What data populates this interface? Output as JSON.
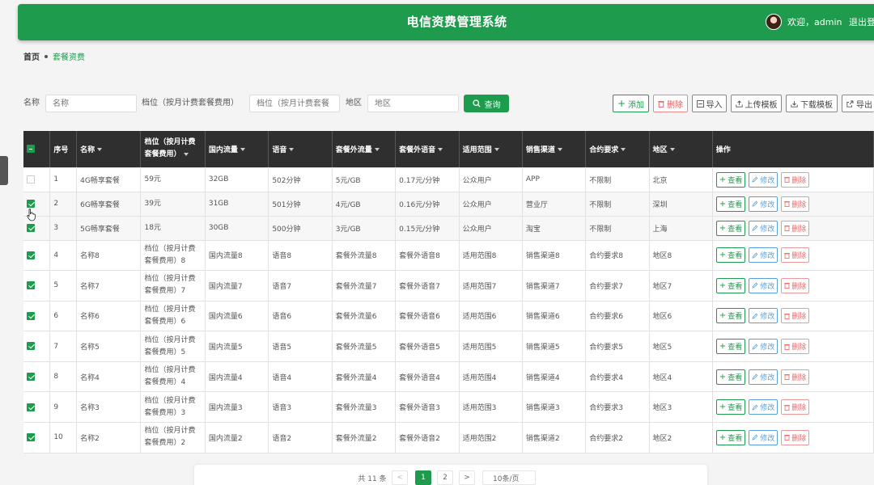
{
  "header": {
    "title": "电信资费管理系统",
    "welcome": "欢迎，admin",
    "logout": "退出登录"
  },
  "breadcrumb": {
    "home": "首页",
    "current": "套餐资费"
  },
  "search": {
    "name_label": "名称",
    "name_placeholder": "名称",
    "tier_label": "档位（按月计费套餐费用）",
    "tier_placeholder": "档位（按月计费套餐",
    "region_label": "地区",
    "region_placeholder": "地区",
    "query_label": "查询"
  },
  "toolbar": {
    "add": "添加",
    "delete": "删除",
    "import": "导入",
    "upload_template": "上传模板",
    "download_template": "下载模板",
    "export": "导出"
  },
  "table": {
    "headers": [
      "序号",
      "名称",
      "档位（按月计费套餐费用）",
      "国内流量",
      "语音",
      "套餐外流量",
      "套餐外语音",
      "适用范围",
      "销售渠道",
      "合约要求",
      "地区",
      "操作"
    ],
    "actions": {
      "view": "查看",
      "edit": "修改",
      "delete": "删除"
    },
    "rows": [
      {
        "checked": false,
        "cells": [
          "1",
          "4G畅享套餐",
          "59元",
          "32GB",
          "502分钟",
          "5元/GB",
          "0.17元/分钟",
          "公众用户",
          "APP",
          "不限制",
          "北京"
        ]
      },
      {
        "checked": true,
        "cells": [
          "2",
          "6G畅享套餐",
          "39元",
          "31GB",
          "501分钟",
          "4元/GB",
          "0.16元/分钟",
          "公众用户",
          "营业厅",
          "不限制",
          "深圳"
        ]
      },
      {
        "checked": true,
        "cells": [
          "3",
          "5G畅享套餐",
          "18元",
          "30GB",
          "500分钟",
          "3元/GB",
          "0.15元/分钟",
          "公众用户",
          "淘宝",
          "不限制",
          "上海"
        ]
      },
      {
        "checked": true,
        "cells": [
          "4",
          "名称8",
          "档位（按月计费套餐费用）8",
          "国内流量8",
          "语音8",
          "套餐外流量8",
          "套餐外语音8",
          "适用范围8",
          "销售渠道8",
          "合约要求8",
          "地区8"
        ]
      },
      {
        "checked": true,
        "cells": [
          "5",
          "名称7",
          "档位（按月计费套餐费用）7",
          "国内流量7",
          "语音7",
          "套餐外流量7",
          "套餐外语音7",
          "适用范围7",
          "销售渠道7",
          "合约要求7",
          "地区7"
        ]
      },
      {
        "checked": true,
        "cells": [
          "6",
          "名称6",
          "档位（按月计费套餐费用）6",
          "国内流量6",
          "语音6",
          "套餐外流量6",
          "套餐外语音6",
          "适用范围6",
          "销售渠道6",
          "合约要求6",
          "地区6"
        ]
      },
      {
        "checked": true,
        "cells": [
          "7",
          "名称5",
          "档位（按月计费套餐费用）5",
          "国内流量5",
          "语音5",
          "套餐外流量5",
          "套餐外语音5",
          "适用范围5",
          "销售渠道5",
          "合约要求5",
          "地区5"
        ]
      },
      {
        "checked": true,
        "cells": [
          "8",
          "名称4",
          "档位（按月计费套餐费用）4",
          "国内流量4",
          "语音4",
          "套餐外流量4",
          "套餐外语音4",
          "适用范围4",
          "销售渠道4",
          "合约要求4",
          "地区4"
        ]
      },
      {
        "checked": true,
        "cells": [
          "9",
          "名称3",
          "档位（按月计费套餐费用）3",
          "国内流量3",
          "语音3",
          "套餐外流量3",
          "套餐外语音3",
          "适用范围3",
          "销售渠道3",
          "合约要求3",
          "地区3"
        ]
      },
      {
        "checked": true,
        "cells": [
          "10",
          "名称2",
          "档位（按月计费套餐费用）2",
          "国内流量2",
          "语音2",
          "套餐外流量2",
          "套餐外语音2",
          "适用范围2",
          "销售渠道2",
          "合约要求2",
          "地区2"
        ]
      }
    ]
  },
  "pagination": {
    "total": "共 11 条",
    "prev": "<",
    "pages": [
      "1",
      "2"
    ],
    "current": "1",
    "next": ">",
    "page_size": "10条/页"
  },
  "colors": {
    "primary": "#1e9b4d",
    "header_bg": "#2f2f2f",
    "danger": "#e55555",
    "edit": "#5aa0d8"
  }
}
